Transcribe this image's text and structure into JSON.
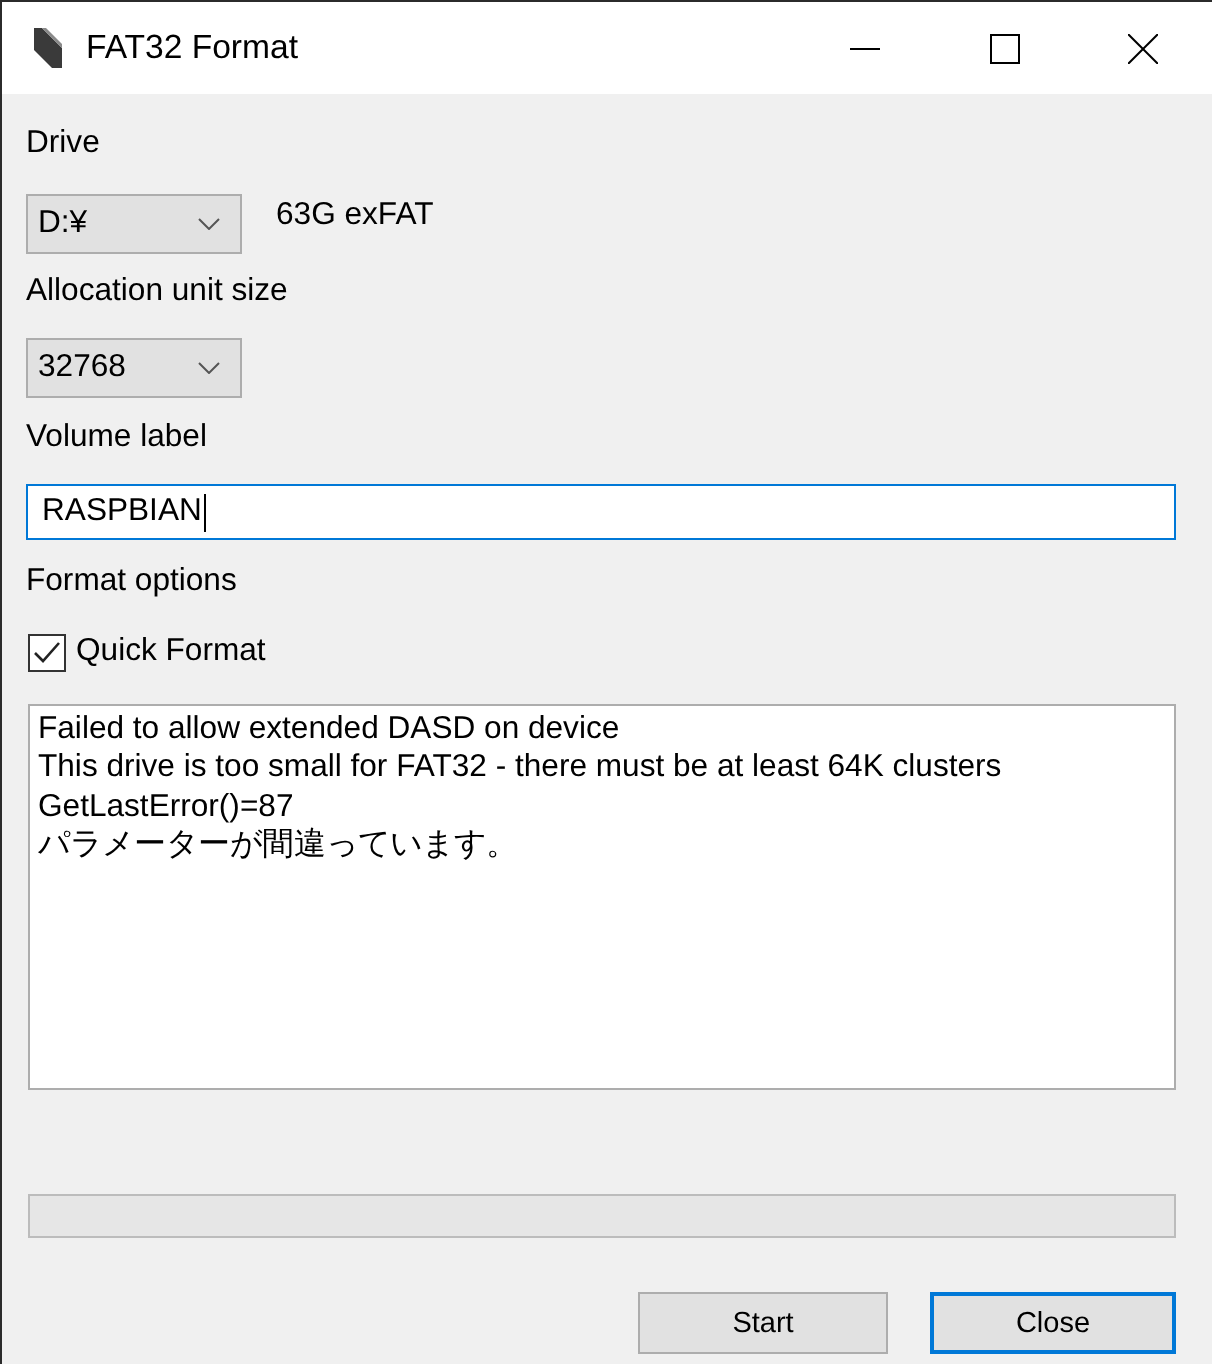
{
  "window": {
    "title": "FAT32 Format"
  },
  "drive": {
    "label": "Drive",
    "value": "D:¥",
    "info": "63G exFAT"
  },
  "allocation_unit_size": {
    "label": "Allocation unit size",
    "value": "32768"
  },
  "volume_label": {
    "label": "Volume label",
    "value": "RASPBIAN",
    "focused": true
  },
  "format_options": {
    "label": "Format options",
    "quick_format": {
      "label": "Quick Format",
      "checked": true
    }
  },
  "log": {
    "lines": [
      "Failed to allow extended DASD on device",
      "This drive is too small for FAT32 - there must be at least 64K clusters",
      "GetLastError()=87",
      "パラメーターが間違っています。"
    ]
  },
  "progress": {
    "level": 0
  },
  "buttons": [
    {
      "label": "Start",
      "default": false
    },
    {
      "label": "Close",
      "default": true
    }
  ]
}
